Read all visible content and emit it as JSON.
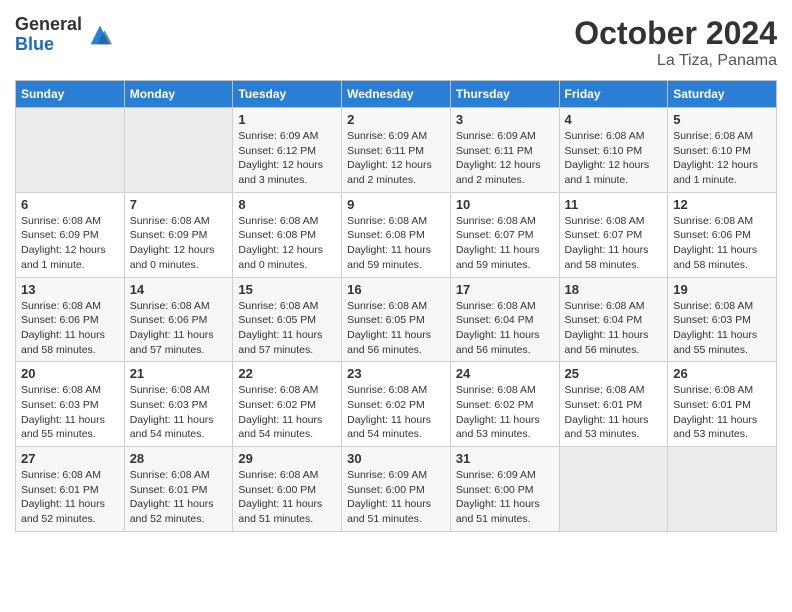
{
  "logo": {
    "general": "General",
    "blue": "Blue"
  },
  "title": "October 2024",
  "subtitle": "La Tiza, Panama",
  "days_of_week": [
    "Sunday",
    "Monday",
    "Tuesday",
    "Wednesday",
    "Thursday",
    "Friday",
    "Saturday"
  ],
  "weeks": [
    [
      {
        "day": "",
        "info": ""
      },
      {
        "day": "",
        "info": ""
      },
      {
        "day": "1",
        "info": "Sunrise: 6:09 AM\nSunset: 6:12 PM\nDaylight: 12 hours and 3 minutes."
      },
      {
        "day": "2",
        "info": "Sunrise: 6:09 AM\nSunset: 6:11 PM\nDaylight: 12 hours and 2 minutes."
      },
      {
        "day": "3",
        "info": "Sunrise: 6:09 AM\nSunset: 6:11 PM\nDaylight: 12 hours and 2 minutes."
      },
      {
        "day": "4",
        "info": "Sunrise: 6:08 AM\nSunset: 6:10 PM\nDaylight: 12 hours and 1 minute."
      },
      {
        "day": "5",
        "info": "Sunrise: 6:08 AM\nSunset: 6:10 PM\nDaylight: 12 hours and 1 minute."
      }
    ],
    [
      {
        "day": "6",
        "info": "Sunrise: 6:08 AM\nSunset: 6:09 PM\nDaylight: 12 hours and 1 minute."
      },
      {
        "day": "7",
        "info": "Sunrise: 6:08 AM\nSunset: 6:09 PM\nDaylight: 12 hours and 0 minutes."
      },
      {
        "day": "8",
        "info": "Sunrise: 6:08 AM\nSunset: 6:08 PM\nDaylight: 12 hours and 0 minutes."
      },
      {
        "day": "9",
        "info": "Sunrise: 6:08 AM\nSunset: 6:08 PM\nDaylight: 11 hours and 59 minutes."
      },
      {
        "day": "10",
        "info": "Sunrise: 6:08 AM\nSunset: 6:07 PM\nDaylight: 11 hours and 59 minutes."
      },
      {
        "day": "11",
        "info": "Sunrise: 6:08 AM\nSunset: 6:07 PM\nDaylight: 11 hours and 58 minutes."
      },
      {
        "day": "12",
        "info": "Sunrise: 6:08 AM\nSunset: 6:06 PM\nDaylight: 11 hours and 58 minutes."
      }
    ],
    [
      {
        "day": "13",
        "info": "Sunrise: 6:08 AM\nSunset: 6:06 PM\nDaylight: 11 hours and 58 minutes."
      },
      {
        "day": "14",
        "info": "Sunrise: 6:08 AM\nSunset: 6:06 PM\nDaylight: 11 hours and 57 minutes."
      },
      {
        "day": "15",
        "info": "Sunrise: 6:08 AM\nSunset: 6:05 PM\nDaylight: 11 hours and 57 minutes."
      },
      {
        "day": "16",
        "info": "Sunrise: 6:08 AM\nSunset: 6:05 PM\nDaylight: 11 hours and 56 minutes."
      },
      {
        "day": "17",
        "info": "Sunrise: 6:08 AM\nSunset: 6:04 PM\nDaylight: 11 hours and 56 minutes."
      },
      {
        "day": "18",
        "info": "Sunrise: 6:08 AM\nSunset: 6:04 PM\nDaylight: 11 hours and 56 minutes."
      },
      {
        "day": "19",
        "info": "Sunrise: 6:08 AM\nSunset: 6:03 PM\nDaylight: 11 hours and 55 minutes."
      }
    ],
    [
      {
        "day": "20",
        "info": "Sunrise: 6:08 AM\nSunset: 6:03 PM\nDaylight: 11 hours and 55 minutes."
      },
      {
        "day": "21",
        "info": "Sunrise: 6:08 AM\nSunset: 6:03 PM\nDaylight: 11 hours and 54 minutes."
      },
      {
        "day": "22",
        "info": "Sunrise: 6:08 AM\nSunset: 6:02 PM\nDaylight: 11 hours and 54 minutes."
      },
      {
        "day": "23",
        "info": "Sunrise: 6:08 AM\nSunset: 6:02 PM\nDaylight: 11 hours and 54 minutes."
      },
      {
        "day": "24",
        "info": "Sunrise: 6:08 AM\nSunset: 6:02 PM\nDaylight: 11 hours and 53 minutes."
      },
      {
        "day": "25",
        "info": "Sunrise: 6:08 AM\nSunset: 6:01 PM\nDaylight: 11 hours and 53 minutes."
      },
      {
        "day": "26",
        "info": "Sunrise: 6:08 AM\nSunset: 6:01 PM\nDaylight: 11 hours and 53 minutes."
      }
    ],
    [
      {
        "day": "27",
        "info": "Sunrise: 6:08 AM\nSunset: 6:01 PM\nDaylight: 11 hours and 52 minutes."
      },
      {
        "day": "28",
        "info": "Sunrise: 6:08 AM\nSunset: 6:01 PM\nDaylight: 11 hours and 52 minutes."
      },
      {
        "day": "29",
        "info": "Sunrise: 6:08 AM\nSunset: 6:00 PM\nDaylight: 11 hours and 51 minutes."
      },
      {
        "day": "30",
        "info": "Sunrise: 6:09 AM\nSunset: 6:00 PM\nDaylight: 11 hours and 51 minutes."
      },
      {
        "day": "31",
        "info": "Sunrise: 6:09 AM\nSunset: 6:00 PM\nDaylight: 11 hours and 51 minutes."
      },
      {
        "day": "",
        "info": ""
      },
      {
        "day": "",
        "info": ""
      }
    ]
  ]
}
